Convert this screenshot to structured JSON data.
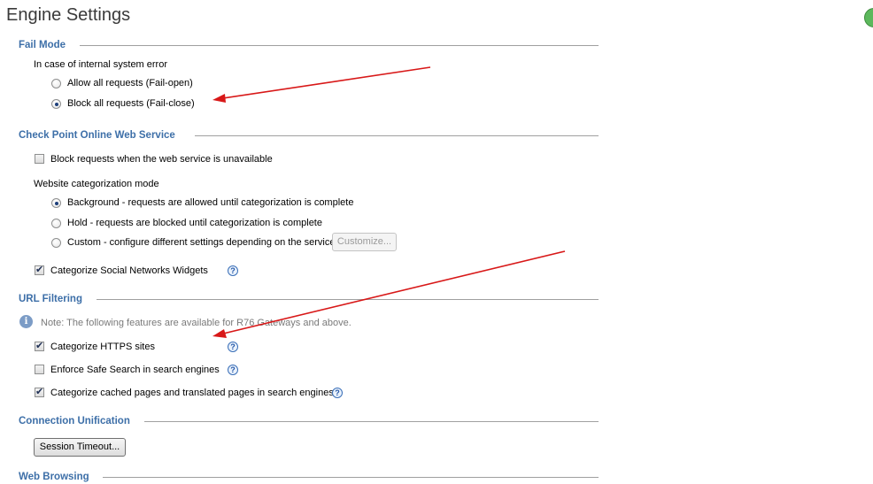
{
  "page": {
    "title": "Engine Settings"
  },
  "fail_mode": {
    "heading": "Fail Mode",
    "prompt": "In case of internal system error",
    "options": [
      {
        "label": "Allow all requests (Fail-open)",
        "selected": false
      },
      {
        "label": "Block all requests (Fail-close)",
        "selected": true
      }
    ]
  },
  "online_service": {
    "heading": "Check Point Online Web Service",
    "block_unavailable": {
      "label": "Block requests when the web service is unavailable",
      "checked": false
    },
    "categorization_prompt": "Website categorization mode",
    "modes": [
      {
        "label": "Background - requests are allowed until categorization is complete",
        "selected": true
      },
      {
        "label": "Hold - requests are blocked until categorization is complete",
        "selected": false
      },
      {
        "label": "Custom - configure different settings depending on the service",
        "selected": false
      }
    ],
    "customize_label": "Customize...",
    "social_widgets": {
      "label": "Categorize Social Networks Widgets",
      "checked": true
    }
  },
  "url_filtering": {
    "heading": "URL Filtering",
    "note": "Note: The following features are available for R76 Gateways and above.",
    "https": {
      "label": "Categorize HTTPS sites",
      "checked": true
    },
    "safe_search": {
      "label": "Enforce Safe Search in search engines",
      "checked": false
    },
    "cached_pages": {
      "label": "Categorize cached pages and translated pages in search engines",
      "checked": true
    }
  },
  "connection_unification": {
    "heading": "Connection Unification",
    "session_timeout_label": "Session Timeout..."
  },
  "web_browsing": {
    "heading": "Web Browsing"
  },
  "colors": {
    "heading": "#3d6fa8",
    "arrow": "#d81818",
    "help": "#2458a8"
  },
  "icons": {
    "help": "?",
    "info": "i"
  }
}
